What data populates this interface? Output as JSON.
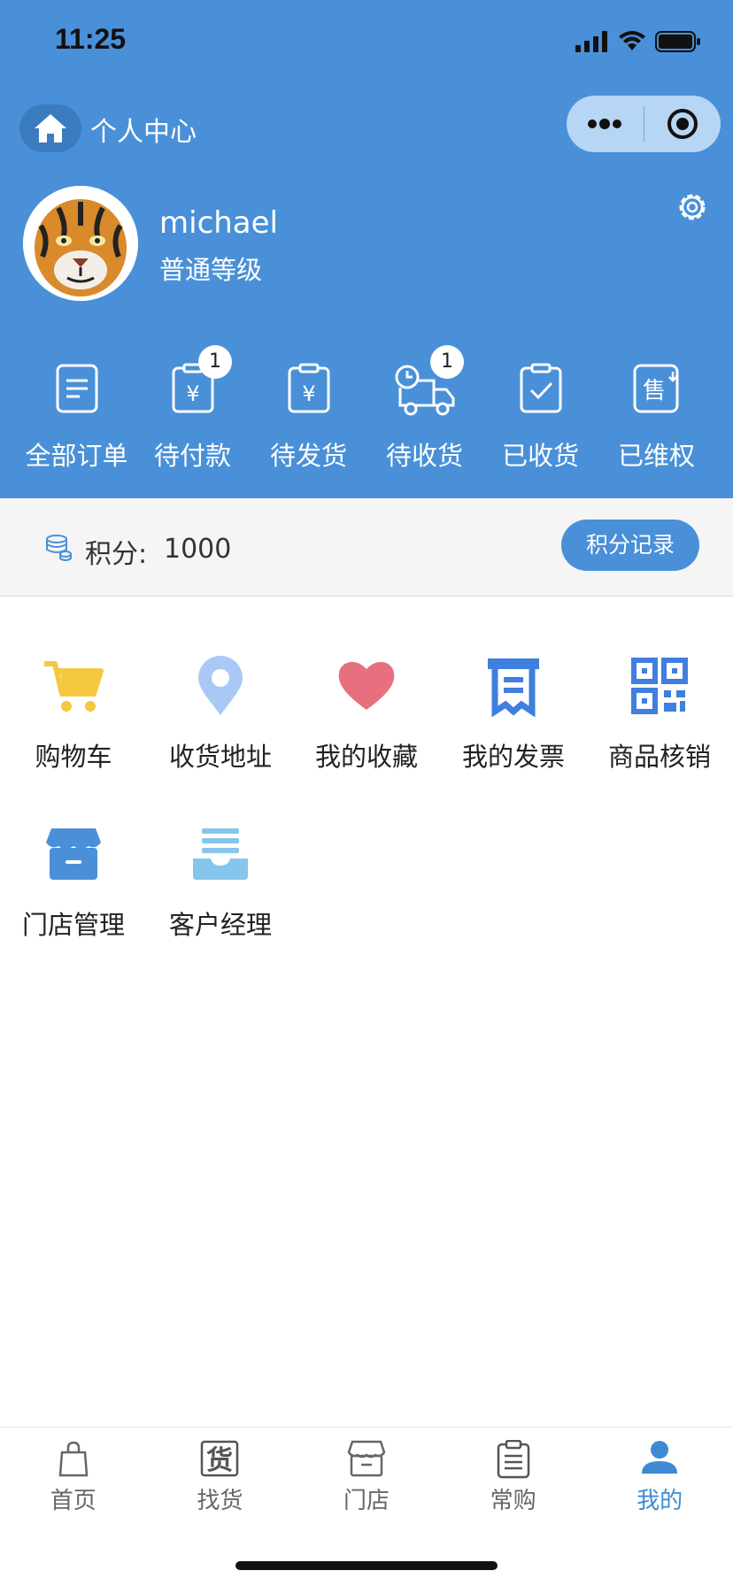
{
  "status_bar": {
    "time": "11:25"
  },
  "nav": {
    "title": "个人中心"
  },
  "user": {
    "name": "michael",
    "level": "普通等级"
  },
  "orders": [
    {
      "label": "全部订单",
      "icon": "order-list-icon",
      "badge": ""
    },
    {
      "label": "待付款",
      "icon": "payment-pending-icon",
      "badge": "1"
    },
    {
      "label": "待发货",
      "icon": "shipping-pending-icon",
      "badge": ""
    },
    {
      "label": "待收货",
      "icon": "delivery-truck-icon",
      "badge": "1"
    },
    {
      "label": "已收货",
      "icon": "received-check-icon",
      "badge": ""
    },
    {
      "label": "已维权",
      "icon": "after-sales-icon",
      "badge": ""
    }
  ],
  "points": {
    "label": "积分:",
    "value": "1000",
    "button": "积分记录"
  },
  "services": [
    {
      "label": "购物车",
      "icon": "cart-icon",
      "color": "#f5c842"
    },
    {
      "label": "收货地址",
      "icon": "location-pin-icon",
      "color": "#a9c8f5"
    },
    {
      "label": "我的收藏",
      "icon": "heart-icon",
      "color": "#e8707e"
    },
    {
      "label": "我的发票",
      "icon": "invoice-icon",
      "color": "#3f7fdf"
    },
    {
      "label": "商品核销",
      "icon": "qr-code-icon",
      "color": "#3f7fdf"
    },
    {
      "label": "门店管理",
      "icon": "store-icon",
      "color": "#4a90d9"
    },
    {
      "label": "客户经理",
      "icon": "inbox-tray-icon",
      "color": "#86c5ec"
    }
  ],
  "tabs": [
    {
      "label": "首页",
      "icon": "shopping-bag-icon",
      "active": false
    },
    {
      "label": "找货",
      "icon": "goods-icon",
      "active": false
    },
    {
      "label": "门店",
      "icon": "shop-icon",
      "active": false
    },
    {
      "label": "常购",
      "icon": "clipboard-icon",
      "active": false
    },
    {
      "label": "我的",
      "icon": "user-icon",
      "active": true
    }
  ],
  "colors": {
    "brand": "#4990d8",
    "active_tab": "#3f8ad3"
  }
}
